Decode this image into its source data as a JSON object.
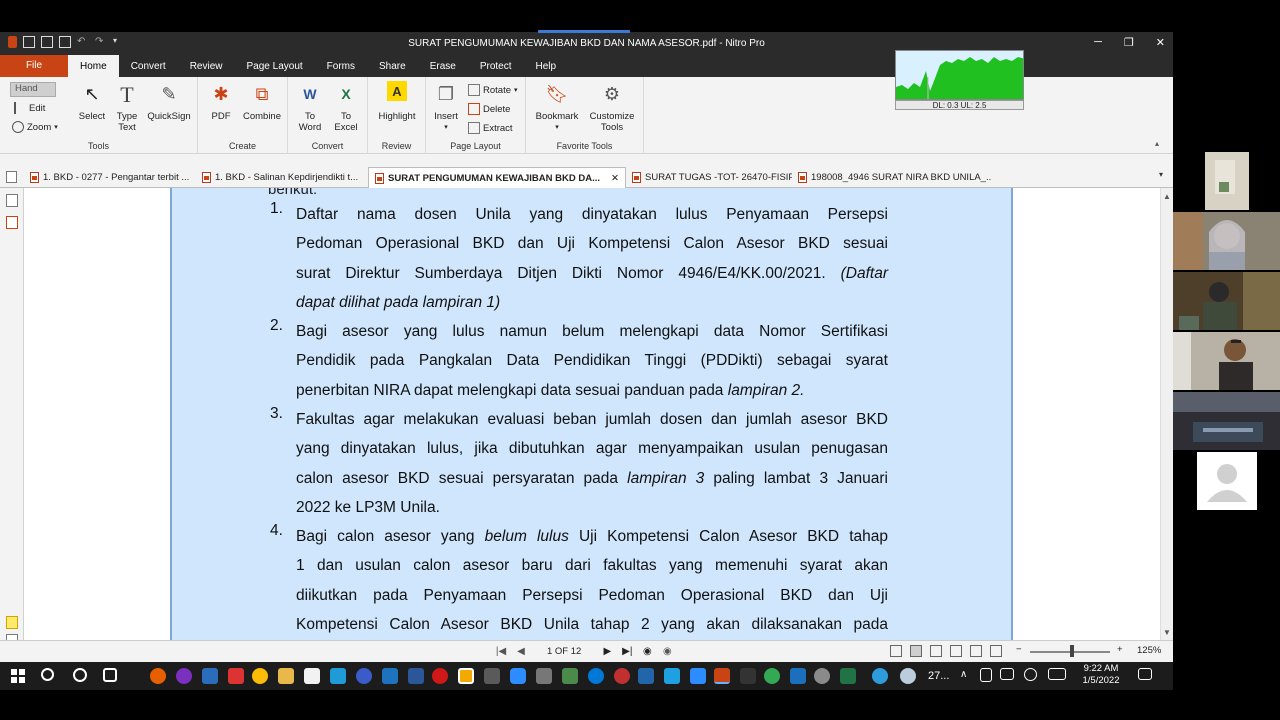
{
  "window": {
    "title": "SURAT PENGUMUMAN KEWAJIBAN BKD DAN NAMA ASESOR.pdf - Nitro Pro"
  },
  "menu": {
    "file": "File",
    "tabs": [
      "Home",
      "Convert",
      "Review",
      "Page Layout",
      "Forms",
      "Share",
      "Erase",
      "Protect",
      "Help"
    ]
  },
  "ribbon": {
    "hand": "Hand",
    "edit": "Edit",
    "zoom": "Zoom",
    "select": "Select",
    "type_text_1": "Type",
    "type_text_2": "Text",
    "quicksign": "QuickSign",
    "tools_group": "Tools",
    "pdf": "PDF",
    "combine": "Combine",
    "create_group": "Create",
    "to_word_1": "To",
    "to_word_2": "Word",
    "to_excel_1": "To",
    "to_excel_2": "Excel",
    "convert_group": "Convert",
    "highlight": "Highlight",
    "review_group": "Review",
    "insert": "Insert",
    "rotate": "Rotate",
    "delete": "Delete",
    "extract": "Extract",
    "page_layout_group": "Page Layout",
    "bookmark": "Bookmark",
    "customize_1": "Customize",
    "customize_2": "Tools",
    "favorite_group": "Favorite Tools"
  },
  "network_widget": {
    "label": "DL: 0.3 UL: 2.5"
  },
  "doc_tabs": [
    "1. BKD - 0277 - Pengantar terbit ...",
    "1. BKD - Salinan Kepdirjendikti t...",
    "SURAT PENGUMUMAN KEWAJIBAN BKD DA...",
    "SURAT TUGAS -TOT- 26470-FISIP",
    "198008_4946 SURAT NIRA BKD UNILA_..."
  ],
  "document": {
    "partial_top": "berikut:",
    "items": [
      {
        "num": "1.",
        "lines": [
          "Daftar nama dosen Unila yang dinyatakan lulus Penyamaan Persepsi",
          "Pedoman Operasional BKD dan Uji Kompetensi Calon Asesor BKD sesuai",
          "surat Direktur Sumberdaya Ditjen Dikti Nomor 4946/E4/KK.00/2021.",
          "dapat dilihat pada lampiran 1)"
        ],
        "italic_tail_line3": "(Daftar"
      },
      {
        "num": "2.",
        "lines": [
          "Bagi asesor yang lulus namun belum melengkapi data Nomor Sertifikasi",
          "Pendidik pada Pangkalan Data Pendidikan Tinggi (PDDikti) sebagai syarat",
          "penerbitan NIRA dapat melengkapi data sesuai panduan pada"
        ],
        "italic_tail_line3": "lampiran 2."
      },
      {
        "num": "3.",
        "lines": [
          "Fakultas agar melakukan evaluasi beban jumlah dosen dan jumlah asesor BKD",
          "yang dinyatakan lulus, jika dibutuhkan agar menyampaikan usulan penugasan",
          "calon asesor BKD sesuai persyaratan pada",
          "2022 ke LP3M Unila."
        ],
        "italic_mid_line3": "lampiran 3",
        "tail_line3": "paling lambat 3 Januari"
      },
      {
        "num": "4.",
        "lines": [
          "Bagi calon asesor yang",
          "1 dan usulan calon asesor baru dari fakultas yang memenuhi syarat akan",
          "diikutkan pada Penyamaan Persepsi Pedoman Operasional BKD dan Uji",
          "Kompetensi Calon Asesor BKD Unila tahap 2 yang akan dilaksanakan pada"
        ],
        "italic_mid_line1": "belum lulus",
        "tail_line1": "Uji Kompetensi Calon Asesor BKD tahap"
      }
    ]
  },
  "status": {
    "page": "1 OF 12",
    "zoom": "125%"
  },
  "taskbar": {
    "weather": "27...",
    "time": "9:22 AM",
    "date": "1/5/2022"
  },
  "colors": {
    "accent": "#c84414",
    "page_highlight": "#cfe6fd"
  }
}
